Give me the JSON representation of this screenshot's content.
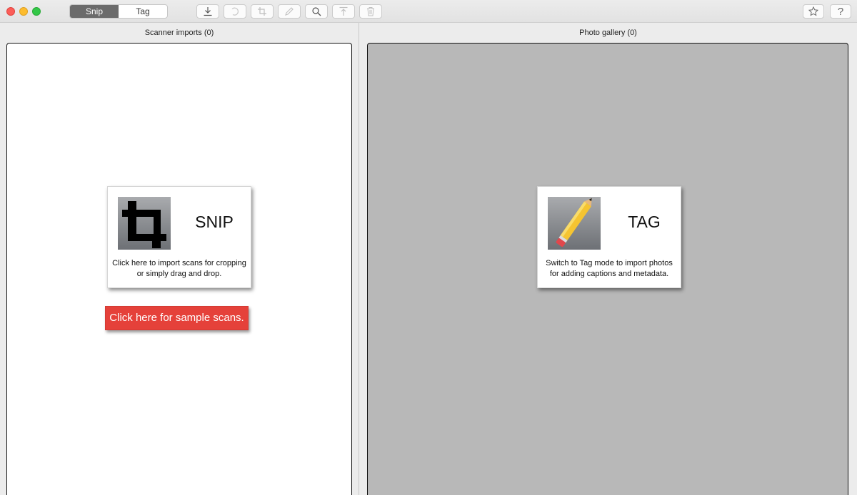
{
  "window": {
    "traffic_lights": [
      "close",
      "minimize",
      "maximize"
    ]
  },
  "mode_switch": {
    "options": [
      {
        "label": "Snip",
        "active": true
      },
      {
        "label": "Tag",
        "active": false
      }
    ]
  },
  "toolbar": {
    "buttons": [
      {
        "name": "import",
        "icon": "download-icon",
        "enabled": true
      },
      {
        "name": "rotate",
        "icon": "rotate-icon",
        "enabled": false
      },
      {
        "name": "crop",
        "icon": "crop-icon",
        "enabled": false
      },
      {
        "name": "edit",
        "icon": "pencil-icon",
        "enabled": false
      },
      {
        "name": "zoom",
        "icon": "search-icon",
        "enabled": true
      },
      {
        "name": "export",
        "icon": "upload-icon",
        "enabled": false
      },
      {
        "name": "delete",
        "icon": "trash-icon",
        "enabled": false
      }
    ],
    "right_buttons": [
      {
        "name": "favorite",
        "icon": "star-icon"
      },
      {
        "name": "help",
        "icon": "help-icon",
        "label": "?"
      }
    ]
  },
  "left_panel": {
    "title": "Scanner imports (0)",
    "card": {
      "title": "SNIP",
      "text_line1": "Click here to import scans for cropping",
      "text_line2": "or simply drag and drop."
    },
    "sample_button": "Click here for sample scans."
  },
  "right_panel": {
    "title": "Photo gallery (0)",
    "card": {
      "title": "TAG",
      "text_line1": "Switch to Tag mode to import photos",
      "text_line2": "for adding captions and metadata."
    }
  },
  "colors": {
    "accent_red": "#e5413a",
    "gallery_bg": "#b8b8b8",
    "active_segment": "#6b6b6b"
  }
}
